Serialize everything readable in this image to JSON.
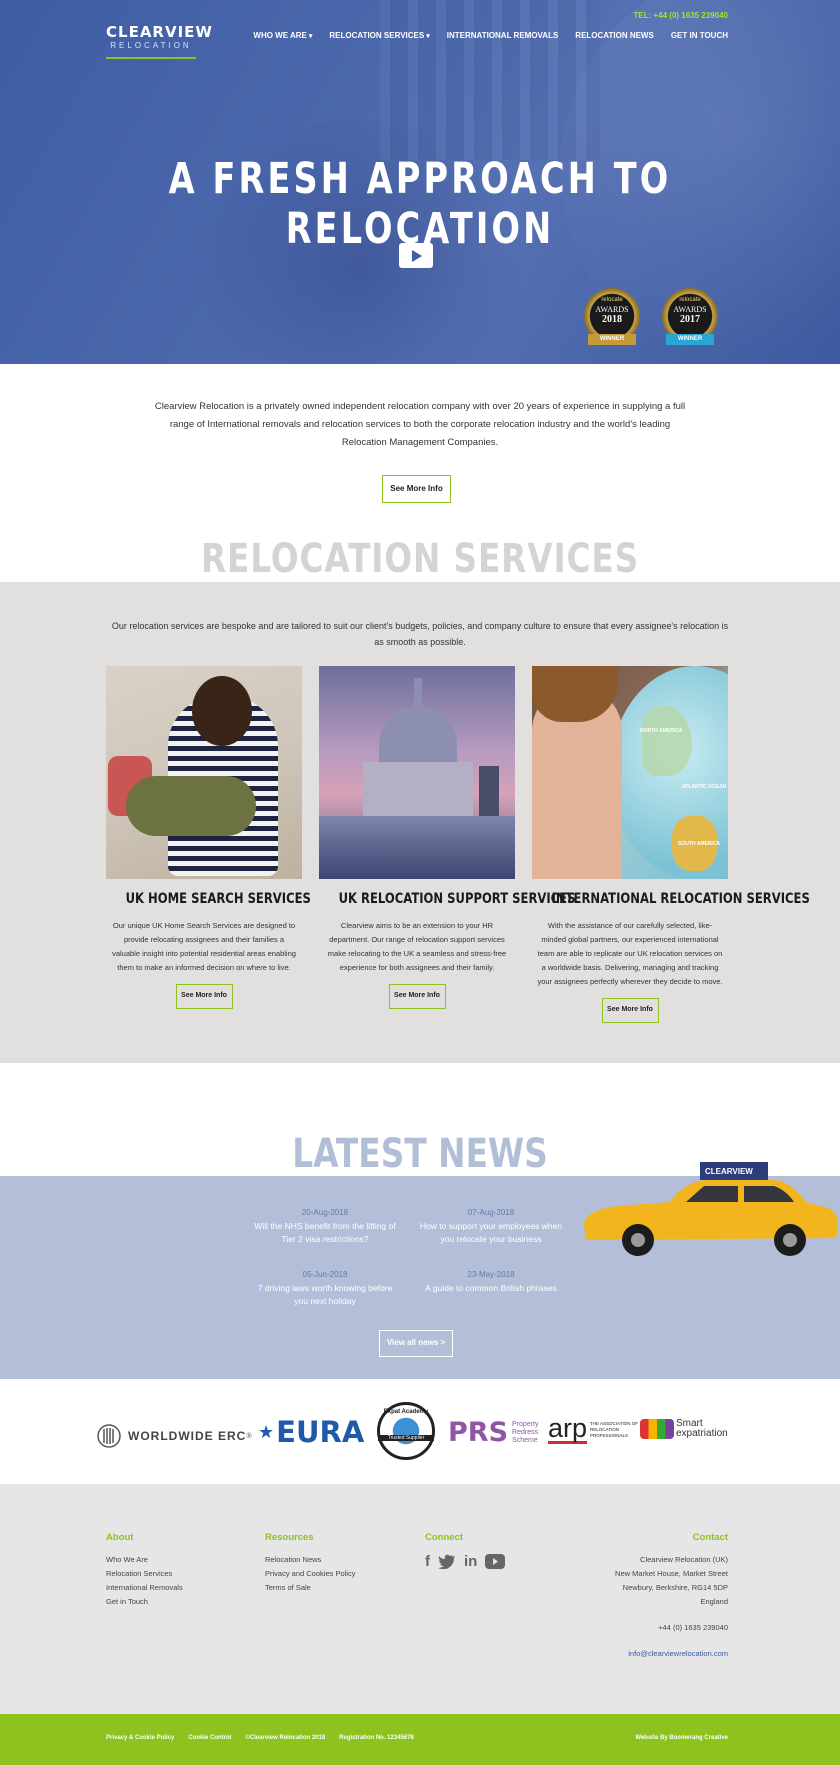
{
  "header": {
    "logo_word": "CLEARVIEW",
    "logo_sub": "RELOCATION",
    "tel": "TEL: +44 (0) 1635 239040",
    "nav": [
      {
        "label": "WHO WE ARE",
        "dropdown": true
      },
      {
        "label": "RELOCATION SERVICES",
        "dropdown": true
      },
      {
        "label": "INTERNATIONAL REMOVALS",
        "dropdown": false
      },
      {
        "label": "RELOCATION NEWS",
        "dropdown": false
      },
      {
        "label": "GET IN TOUCH",
        "dropdown": false
      }
    ]
  },
  "hero": {
    "title": "A FRESH APPROACH TO RELOCATION",
    "play_icon": "play-icon",
    "awards": [
      {
        "top": "relocate",
        "name": "AWARDS",
        "year": "2018",
        "ribbon": "WINNER"
      },
      {
        "top": "relocate",
        "name": "AWARDS",
        "year": "2017",
        "ribbon": "WINNER"
      }
    ]
  },
  "intro": {
    "text": "Clearview Relocation is a privately owned independent relocation company with over 20 years of experience in supplying a full range of International removals and relocation services to both the corporate relocation industry and the world's leading Relocation Management Companies.",
    "button": "See More Info"
  },
  "services": {
    "heading": "RELOCATION SERVICES",
    "lead": "Our relocation services are bespoke and are tailored to suit our client's budgets, policies, and company culture to ensure that every assignee's relocation is as smooth as possible.",
    "cards": [
      {
        "title": "UK HOME SEARCH SERVICES",
        "text": "Our unique UK Home Search Services are designed to provide relocating assignees and their families a valuable insight into potential residential areas enabling them to make an informed decision on where to live.",
        "button": "See More Info"
      },
      {
        "title": "UK RELOCATION SUPPORT SERVICES",
        "text": "Clearview aims to be an extension to your HR department. Our range of relocation support services make relocating to the UK a seamless and stress-free experience for both assignees and their family.",
        "button": "See More Info"
      },
      {
        "title": "INTERNATIONAL RELOCATION SERVICES",
        "text": "With the assistance of our carefully selected, like-minded global partners, our experienced international team are able to replicate our UK relocation services on a worldwide basis. Delivering, managing and tracking your assignees perfectly wherever they decide to move.",
        "button": "See More Info",
        "globe_labels": [
          "NORTH AMERICA",
          "ATLANTIC OCEAN",
          "SOUTH AMERICA"
        ]
      }
    ]
  },
  "news": {
    "heading": "LATEST NEWS",
    "items": [
      {
        "date": "20-Aug-2018",
        "title": "Will the NHS benefit from the lifting of Tier 2 visa restrictions?"
      },
      {
        "date": "07-Aug-2018",
        "title": "How to support your employees when you relocate your business"
      },
      {
        "date": "05-Jun-2018",
        "title": "7 driving laws worth knowing before you next holiday"
      },
      {
        "date": "23-May-2018",
        "title": "A guide to common British phrases"
      }
    ],
    "button": "View all news >",
    "taxi_sign": "CLEARVIEW"
  },
  "partners": {
    "wwerc": "WORLDWIDE ERC",
    "wwerc_mark": "®",
    "eura": "EURA",
    "expert_top": "Expat Academy",
    "expert_band": "Trusted Supplier",
    "prs": "PRS",
    "prs_sub": "Property Redress Scheme",
    "arp": "arp",
    "arp_sub": "THE ASSOCIATION OF RELOCATION PROFESSIONALS",
    "smart_1": "Smart",
    "smart_2": "expatriation"
  },
  "footer": {
    "about": {
      "heading": "About",
      "links": [
        "Who We Are",
        "Relocation Services",
        "International Removals",
        "Get in Touch"
      ]
    },
    "resources": {
      "heading": "Resources",
      "links": [
        "Relocation News",
        "Privacy and Cookies Policy",
        "Terms of Sale"
      ]
    },
    "connect": {
      "heading": "Connect",
      "icons": [
        "facebook-icon",
        "twitter-icon",
        "linkedin-icon",
        "youtube-icon"
      ]
    },
    "contact": {
      "heading": "Contact",
      "address": [
        "Clearview Relocation (UK)",
        "New Market House, Market Street",
        "Newbury, Berkshire, RG14 5DP",
        "England"
      ],
      "phone": "+44 (0) 1635 239040",
      "email": "info@clearviewrelocation.com"
    }
  },
  "bottom_bar": {
    "links": [
      "Privacy & Cookie Policy",
      "Cookie Control",
      "©Clearview Relocation 2018",
      "Registration No. 12345678"
    ],
    "credit": "Website By Boomerang Creative"
  },
  "colors": {
    "accent": "#8dc21f",
    "hero_blue": "#4a67ac",
    "news_bg": "#b3bfd8",
    "services_bg": "#e2e0de"
  }
}
